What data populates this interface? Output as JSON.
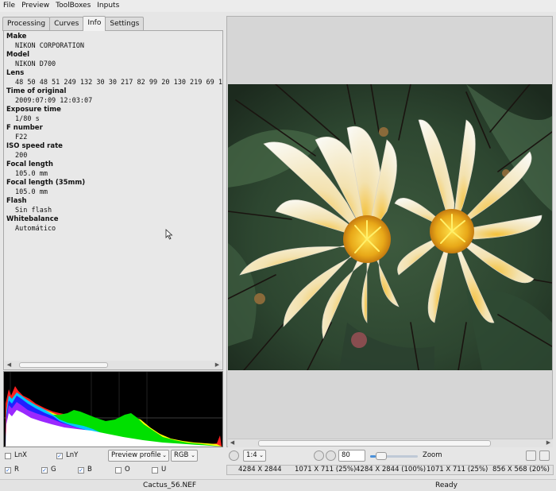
{
  "menu": [
    "File",
    "Preview",
    "ToolBoxes",
    "Inputs"
  ],
  "tabs": [
    {
      "label": "Processing",
      "active": false
    },
    {
      "label": "Curves",
      "active": false
    },
    {
      "label": "Info",
      "active": true
    },
    {
      "label": "Settings",
      "active": false
    }
  ],
  "exif": [
    {
      "label": "Make",
      "value": "NIKON CORPORATION"
    },
    {
      "label": "Model",
      "value": "NIKON D700"
    },
    {
      "label": "Lens",
      "value": "48 50 48 51 249 132 30 30 217 82 99 20 130 219 69 1"
    },
    {
      "label": "Time of original",
      "value": "2009:07:09 12:03:07"
    },
    {
      "label": "Exposure time",
      "value": "1/80 s"
    },
    {
      "label": "F number",
      "value": "F22"
    },
    {
      "label": "ISO speed rate",
      "value": "200"
    },
    {
      "label": "Focal length",
      "value": "105.0 mm"
    },
    {
      "label": "Focal length (35mm)",
      "value": "105.0 mm"
    },
    {
      "label": "Flash",
      "value": "Sin flash"
    },
    {
      "label": "Whitebalance",
      "value": "Automático"
    }
  ],
  "controls": {
    "lnx_label": "LnX",
    "lnx_checked": false,
    "lny_label": "LnY",
    "lny_checked": true,
    "preview_profile": "Preview profile",
    "colorspace": "RGB",
    "zoom_ratio": "1:4",
    "zoom_value": "80",
    "zoom_label": "Zoom",
    "zoom_slider_level": 0.12,
    "channels": [
      {
        "label": "R",
        "checked": true
      },
      {
        "label": "G",
        "checked": true
      },
      {
        "label": "B",
        "checked": true
      },
      {
        "label": "O",
        "checked": false
      },
      {
        "label": "U",
        "checked": false
      }
    ]
  },
  "image_sizes": {
    "s1": "4284 X 2844",
    "s2": "1071 X 711 (25%)",
    "s3": "4284 X 2844 (100%)",
    "s4": "1071 X 711 (25%)",
    "s5": "856 X 568 (20%)"
  },
  "status": {
    "filename": "Cactus_56.NEF",
    "state": "Ready"
  },
  "icons": {
    "check_on": "✓",
    "caret": "⌄",
    "arrow_left": "◀",
    "arrow_right": "▶"
  }
}
